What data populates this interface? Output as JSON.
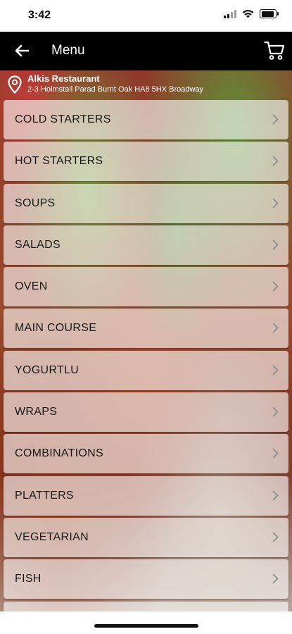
{
  "status_bar": {
    "time": "3:42"
  },
  "header": {
    "title": "Menu",
    "back_icon": "arrow-left-icon",
    "cart_icon": "cart-icon"
  },
  "restaurant": {
    "name": "Alkis Restaurant",
    "address": "2-3 Holmstall Parad Burnt Oak HA8 5HX Broadway",
    "pin_icon": "location-pin-icon"
  },
  "menu": {
    "categories": [
      "COLD STARTERS",
      "HOT STARTERS",
      "SOUPS",
      "SALADS",
      "OVEN",
      "MAIN COURSE",
      "YOGURTLU",
      "WRAPS",
      "COMBINATIONS",
      "PLATTERS",
      "VEGETARIAN",
      "FISH",
      ""
    ],
    "chevron_icon": "chevron-right-icon"
  },
  "colors": {
    "app_bar": "#000000",
    "card_bg": "rgba(255,255,255,0.62)",
    "text": "#1a1a1a"
  }
}
